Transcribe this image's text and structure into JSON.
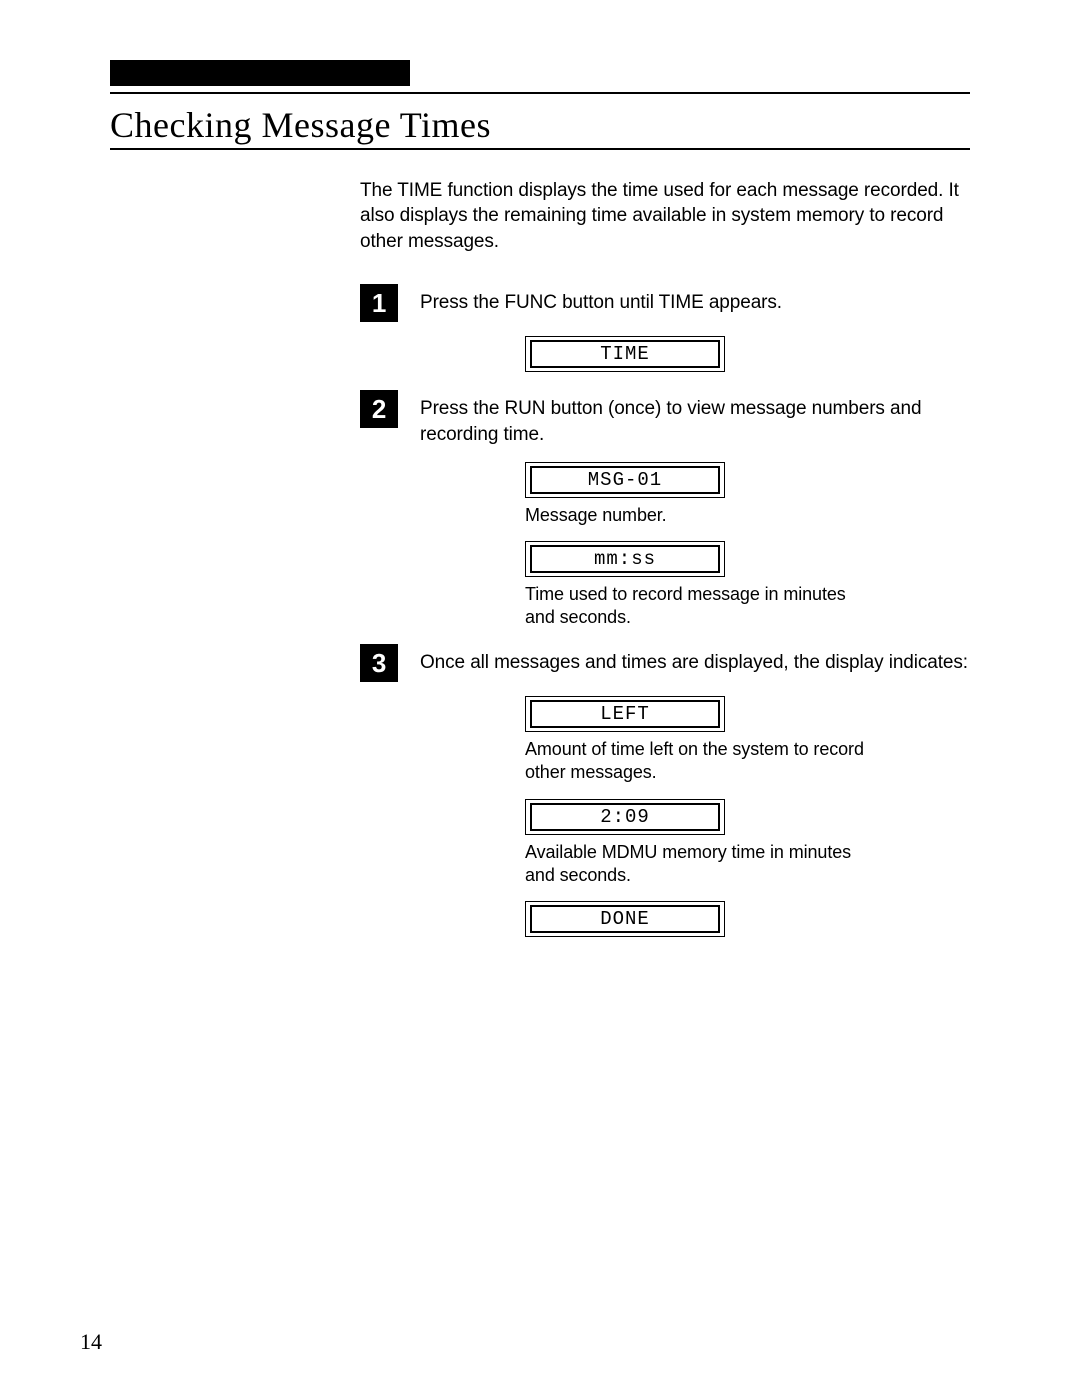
{
  "heading": "Checking Message Times",
  "intro": "The TIME function displays the time used for each message recorded. It also displays the remaining time available in system memory to record other messages.",
  "steps": {
    "step1": {
      "num": "1",
      "text": "Press the FUNC button until TIME appears.",
      "lcds": [
        {
          "value": "TIME",
          "caption": ""
        }
      ]
    },
    "step2": {
      "num": "2",
      "text": "Press the RUN button (once) to view message numbers and recording time.",
      "lcds": [
        {
          "value": "MSG-01",
          "caption": "Message number."
        },
        {
          "value": "mm:ss",
          "caption": "Time used to record message in minutes and seconds."
        }
      ]
    },
    "step3": {
      "num": "3",
      "text": "Once all messages and times are displayed, the display indicates:",
      "lcds": [
        {
          "value": "LEFT",
          "caption": "Amount of time left on the system to record other messages."
        },
        {
          "value": "2:09",
          "caption": "Available MDMU memory time in minutes and seconds."
        },
        {
          "value": "DONE",
          "caption": ""
        }
      ]
    }
  },
  "pagenum": "14"
}
